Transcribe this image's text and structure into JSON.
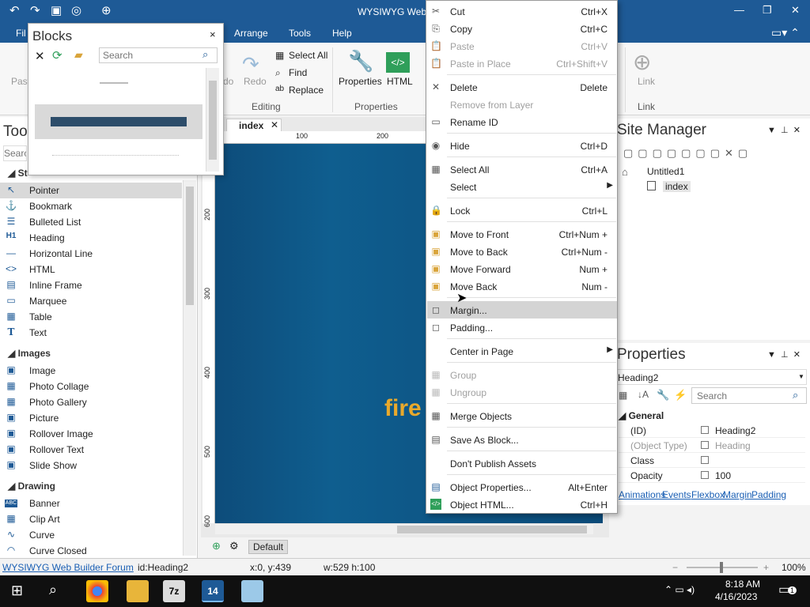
{
  "window": {
    "title": "WYSIWYG Web B"
  },
  "menubar": {
    "items": [
      "Fil",
      "Arrange",
      "Tools",
      "Help"
    ]
  },
  "ribbon": {
    "paste": "Paste",
    "undo": "do",
    "redo": "Redo",
    "select_all": "Select All",
    "find": "Find",
    "replace": "Replace",
    "properties": "Properties",
    "html": "HTML",
    "link": "Link",
    "groups": {
      "editing": "Editing",
      "properties": "Properties",
      "link": "Link"
    }
  },
  "blocks": {
    "title": "Blocks",
    "search_placeholder": "Search",
    "close": "×"
  },
  "toolbox": {
    "title": "Too",
    "search_placeholder": "Searc",
    "categories": {
      "standard": "St",
      "images": "Images",
      "drawing": "Drawing"
    },
    "standard_items": [
      "Pointer",
      "Bookmark",
      "Bulleted List",
      "Heading",
      "Horizontal Line",
      "HTML",
      "Inline Frame",
      "Marquee",
      "Table",
      "Text"
    ],
    "image_items": [
      "Image",
      "Photo Collage",
      "Photo Gallery",
      "Picture",
      "Rollover Image",
      "Rollover Text",
      "Slide Show"
    ],
    "drawing_items": [
      "Banner",
      "Clip Art",
      "Curve",
      "Curve Closed"
    ]
  },
  "document": {
    "tab": "index",
    "ruler_top": [
      "100",
      "200"
    ],
    "ruler_left": [
      "200",
      "300",
      "400",
      "500",
      "600"
    ],
    "heading_text": "fire",
    "bottom_mode": "Default"
  },
  "context_menu": {
    "items": [
      {
        "label": "Cut",
        "shortcut": "Ctrl+X",
        "icon": "✂"
      },
      {
        "label": "Copy",
        "shortcut": "Ctrl+C",
        "icon": "⎘"
      },
      {
        "label": "Paste",
        "shortcut": "Ctrl+V",
        "icon": "📋"
      },
      {
        "label": "Paste in Place",
        "shortcut": "Ctrl+Shift+V",
        "icon": "📋"
      },
      {
        "label": "Delete",
        "shortcut": "Delete",
        "icon": "✕"
      },
      {
        "label": "Remove from Layer",
        "shortcut": "",
        "icon": ""
      },
      {
        "label": "Rename ID",
        "shortcut": "",
        "icon": "▭"
      },
      {
        "label": "Hide",
        "shortcut": "Ctrl+D",
        "icon": "◉"
      },
      {
        "label": "Select All",
        "shortcut": "Ctrl+A",
        "icon": "▦"
      },
      {
        "label": "Select",
        "shortcut": "",
        "icon": ""
      },
      {
        "label": "Lock",
        "shortcut": "Ctrl+L",
        "icon": "🔒"
      },
      {
        "label": "Move to Front",
        "shortcut": "Ctrl+Num +",
        "icon": "▣"
      },
      {
        "label": "Move to Back",
        "shortcut": "Ctrl+Num -",
        "icon": "▣"
      },
      {
        "label": "Move Forward",
        "shortcut": "Num +",
        "icon": "▣"
      },
      {
        "label": "Move Back",
        "shortcut": "Num -",
        "icon": "▣"
      },
      {
        "label": "Margin...",
        "shortcut": "",
        "icon": "◻"
      },
      {
        "label": "Padding...",
        "shortcut": "",
        "icon": "◻"
      },
      {
        "label": "Center in Page",
        "shortcut": "",
        "icon": ""
      },
      {
        "label": "Group",
        "shortcut": "",
        "icon": "▦"
      },
      {
        "label": "Ungroup",
        "shortcut": "",
        "icon": "▦"
      },
      {
        "label": "Merge Objects",
        "shortcut": "",
        "icon": "▦"
      },
      {
        "label": "Save As Block...",
        "shortcut": "",
        "icon": "▤"
      },
      {
        "label": "Don't Publish Assets",
        "shortcut": "",
        "icon": ""
      },
      {
        "label": "Object Properties...",
        "shortcut": "Alt+Enter",
        "icon": "▤"
      },
      {
        "label": "Object HTML...",
        "shortcut": "Ctrl+H",
        "icon": "</>"
      }
    ]
  },
  "site_manager": {
    "title": "Site Manager",
    "root": "Untitled1",
    "page": "index"
  },
  "properties": {
    "title": "Properties",
    "selected": "Heading2",
    "search_placeholder": "Search",
    "category": "General",
    "rows": [
      {
        "key": "(ID)",
        "value": "Heading2"
      },
      {
        "key": "(Object Type)",
        "value": "Heading"
      },
      {
        "key": "Class",
        "value": ""
      },
      {
        "key": "Opacity",
        "value": "100"
      }
    ],
    "links": [
      "Animations",
      "Events",
      "Flexbox",
      "Margin",
      "Padding"
    ]
  },
  "status": {
    "forum": "WYSIWYG Web Builder Forum",
    "id": "id:Heading2",
    "pos": "x:0, y:439",
    "size": "w:529 h:100",
    "zoom": "100%"
  },
  "taskbar": {
    "time": "8:18 AM",
    "date": "4/16/2023",
    "notifications": "1"
  }
}
